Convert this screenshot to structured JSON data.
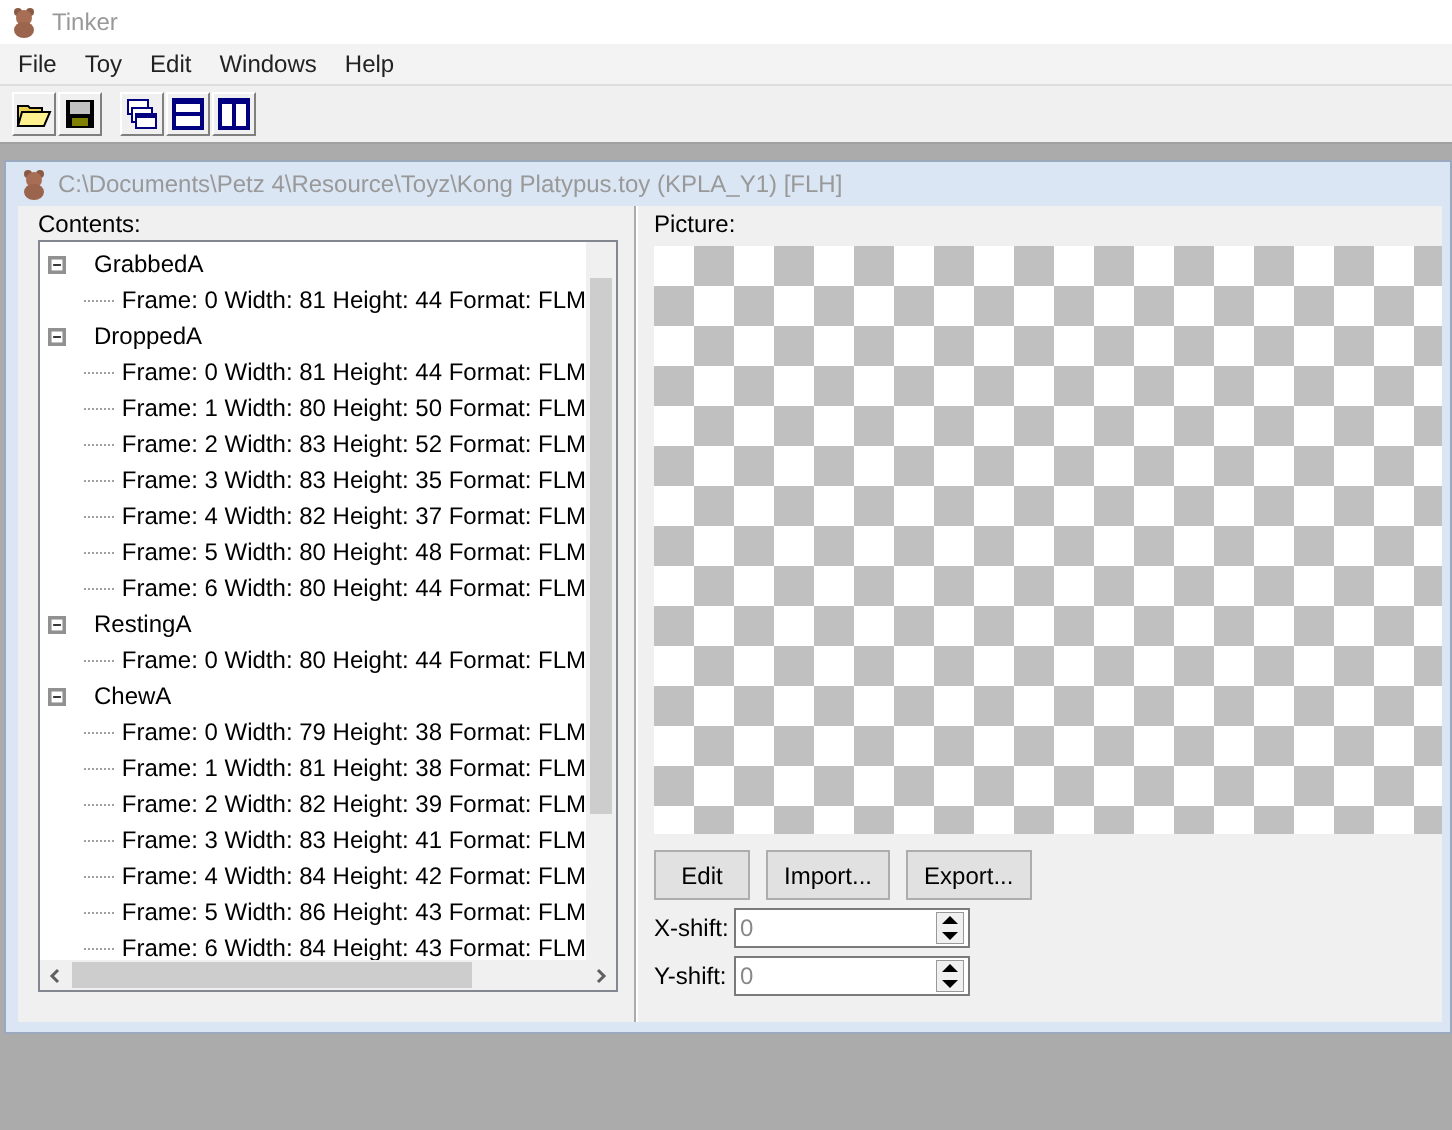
{
  "app": {
    "title": "Tinker"
  },
  "menu": [
    "File",
    "Toy",
    "Edit",
    "Windows",
    "Help"
  ],
  "toolbar": [
    {
      "kind": "open"
    },
    {
      "kind": "save"
    },
    {
      "kind": "cascade"
    },
    {
      "kind": "tile-h"
    },
    {
      "kind": "tile-v"
    }
  ],
  "document": {
    "title": "C:\\Documents\\Petz 4\\Resource\\Toyz\\Kong Platypus.toy (KPLA_Y1) [FLH]",
    "contents_label": "Contents:",
    "tree": [
      {
        "label": "GrabbedA",
        "expanded": true,
        "children": [
          {
            "label": "Frame: 0 Width: 81 Height: 44 Format: FLM"
          }
        ]
      },
      {
        "label": "DroppedA",
        "expanded": true,
        "children": [
          {
            "label": "Frame: 0 Width: 81 Height: 44 Format: FLM"
          },
          {
            "label": "Frame: 1 Width: 80 Height: 50 Format: FLM"
          },
          {
            "label": "Frame: 2 Width: 83 Height: 52 Format: FLM"
          },
          {
            "label": "Frame: 3 Width: 83 Height: 35 Format: FLM"
          },
          {
            "label": "Frame: 4 Width: 82 Height: 37 Format: FLM"
          },
          {
            "label": "Frame: 5 Width: 80 Height: 48 Format: FLM"
          },
          {
            "label": "Frame: 6 Width: 80 Height: 44 Format: FLM"
          }
        ]
      },
      {
        "label": "RestingA",
        "expanded": true,
        "children": [
          {
            "label": "Frame: 0 Width: 80 Height: 44 Format: FLM"
          }
        ]
      },
      {
        "label": "ChewA",
        "expanded": true,
        "children": [
          {
            "label": "Frame: 0 Width: 79 Height: 38 Format: FLM"
          },
          {
            "label": "Frame: 1 Width: 81 Height: 38 Format: FLM"
          },
          {
            "label": "Frame: 2 Width: 82 Height: 39 Format: FLM"
          },
          {
            "label": "Frame: 3 Width: 83 Height: 41 Format: FLM"
          },
          {
            "label": "Frame: 4 Width: 84 Height: 42 Format: FLM"
          },
          {
            "label": "Frame: 5 Width: 86 Height: 43 Format: FLM"
          },
          {
            "label": "Frame: 6 Width: 84 Height: 43 Format: FLM"
          }
        ]
      }
    ],
    "picture_label": "Picture:",
    "buttons": [
      "Edit",
      "Import...",
      "Export..."
    ],
    "fields": [
      {
        "label": "X-shift:",
        "value": "0"
      },
      {
        "label": "Y-shift:",
        "value": "0"
      }
    ]
  }
}
